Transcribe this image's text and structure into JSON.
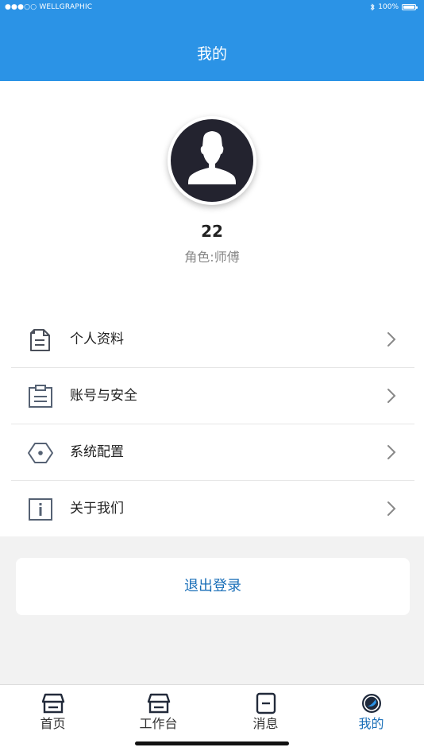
{
  "status_bar": {
    "carrier": "●●●○○ WELLGRAPHIC",
    "battery": "100%"
  },
  "header": {
    "title": "我的"
  },
  "profile": {
    "username": "22",
    "role": "角色:师傅"
  },
  "menu": {
    "items": [
      {
        "label": "个人资料",
        "icon": "document-icon"
      },
      {
        "label": "账号与安全",
        "icon": "clipboard-icon"
      },
      {
        "label": "系统配置",
        "icon": "hexagon-settings-icon"
      },
      {
        "label": "关于我们",
        "icon": "info-icon"
      }
    ]
  },
  "logout": {
    "label": "退出登录"
  },
  "tabbar": {
    "tabs": [
      {
        "label": "首页",
        "icon": "home-icon",
        "active": false
      },
      {
        "label": "工作台",
        "icon": "workbench-icon",
        "active": false
      },
      {
        "label": "消息",
        "icon": "message-icon",
        "active": false
      },
      {
        "label": "我的",
        "icon": "profile-icon",
        "active": true
      }
    ]
  },
  "colors": {
    "header_bg": "#2b93e6",
    "accent": "#1a6fb8",
    "icon_gray": "#556173"
  }
}
